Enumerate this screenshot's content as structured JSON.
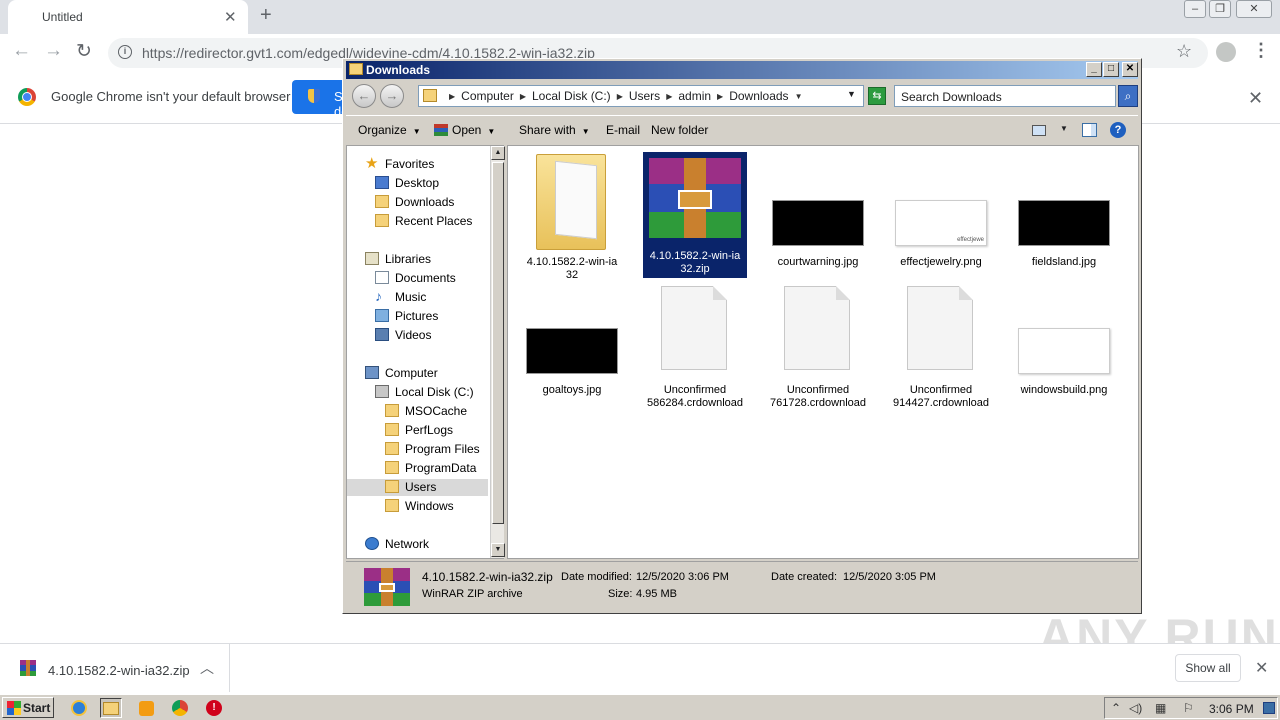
{
  "browser": {
    "tab_title": "Untitled",
    "url": "https://redirector.gvt1.com/edgedl/widevine-cdm/4.10.1582.2-win-ia32.zip",
    "infobar_text": "Google Chrome isn't your default browser",
    "set_default_label": "Set as default",
    "download_item": "4.10.1582.2-win-ia32.zip",
    "show_all": "Show all",
    "watermark": "ANY RUN"
  },
  "explorer": {
    "title": "Downloads",
    "breadcrumbs": [
      "Computer",
      "Local Disk (C:)",
      "Users",
      "admin",
      "Downloads"
    ],
    "search_placeholder": "Search Downloads",
    "commands": {
      "organize": "Organize",
      "open": "Open",
      "share_with": "Share with",
      "email": "E-mail",
      "new_folder": "New folder"
    },
    "nav": {
      "favorites": "Favorites",
      "desktop": "Desktop",
      "downloads": "Downloads",
      "recent_places": "Recent Places",
      "libraries": "Libraries",
      "documents": "Documents",
      "music": "Music",
      "pictures": "Pictures",
      "videos": "Videos",
      "computer": "Computer",
      "local_disk": "Local Disk (C:)",
      "msocache": "MSOCache",
      "perflogs": "PerfLogs",
      "program_files": "Program Files",
      "programdata": "ProgramData",
      "users": "Users",
      "windows": "Windows",
      "network": "Network"
    },
    "files": [
      {
        "name_l1": "4.10.1582.2-win-ia",
        "name_l2": "32",
        "kind": "folder"
      },
      {
        "name_l1": "4.10.1582.2-win-ia",
        "name_l2": "32.zip",
        "kind": "winrar",
        "selected": true
      },
      {
        "name_l1": "courtwarning.jpg",
        "name_l2": "",
        "kind": "black-image"
      },
      {
        "name_l1": "effectjewelry.png",
        "name_l2": "",
        "kind": "white-image",
        "mark": "effectjewe"
      },
      {
        "name_l1": "fieldsland.jpg",
        "name_l2": "",
        "kind": "black-image"
      },
      {
        "name_l1": "goaltoys.jpg",
        "name_l2": "",
        "kind": "black-image"
      },
      {
        "name_l1": "Unconfirmed",
        "name_l2": "586284.crdownload",
        "kind": "document"
      },
      {
        "name_l1": "Unconfirmed",
        "name_l2": "761728.crdownload",
        "kind": "document"
      },
      {
        "name_l1": "Unconfirmed",
        "name_l2": "914427.crdownload",
        "kind": "document"
      },
      {
        "name_l1": "windowsbuild.png",
        "name_l2": "",
        "kind": "white-image"
      }
    ],
    "details": {
      "name": "4.10.1582.2-win-ia32.zip",
      "type": "WinRAR ZIP archive",
      "date_modified_label": "Date modified:",
      "date_modified": "12/5/2020 3:06 PM",
      "date_created_label": "Date created:",
      "date_created": "12/5/2020 3:05 PM",
      "size_label": "Size:",
      "size": "4.95 MB"
    }
  },
  "taskbar": {
    "start_label": "Start",
    "clock": "3:06 PM"
  }
}
